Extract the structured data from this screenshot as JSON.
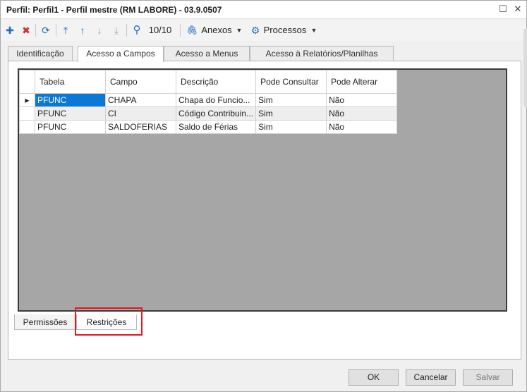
{
  "window": {
    "title": "Perfil: Perfil1 - Perfil mestre (RM LABORE) - 03.9.0507",
    "maximize_glyph": "☐",
    "close_glyph": "✕"
  },
  "toolbar": {
    "add_glyph": "✚",
    "delete_glyph": "✖",
    "refresh_glyph": "⟳",
    "first_glyph": "⤒",
    "prev_glyph": "↑",
    "next_glyph": "↓",
    "last_glyph": "⤓",
    "search_glyph": "⚲",
    "record_position": "10/10",
    "attachments_glyph": "🖇",
    "attachments_label": "Anexos",
    "processes_glyph": "⚙",
    "processes_label": "Processos",
    "dropdown_glyph": "▼"
  },
  "tabs": [
    {
      "label": "Identificação",
      "active": false
    },
    {
      "label": "Acesso a Campos",
      "active": true
    },
    {
      "label": "Acesso a Menus",
      "active": false
    },
    {
      "label": "Acesso à Relatórios/Planilhas",
      "active": false
    }
  ],
  "grid": {
    "columns": [
      "Tabela",
      "Campo",
      "Descrição",
      "Pode Consultar",
      "Pode Alterar"
    ],
    "current_row_glyph": "▶",
    "rows": [
      {
        "tabela": "PFUNC",
        "campo": "CHAPA",
        "descricao": "Chapa do Funcio...",
        "consultar": "Sim",
        "alterar": "Não"
      },
      {
        "tabela": "PFUNC",
        "campo": "CI",
        "descricao": "Código Contribuin...",
        "consultar": "Sim",
        "alterar": "Não"
      },
      {
        "tabela": "PFUNC",
        "campo": "SALDOFERIAS",
        "descricao": "Saldo de Férias",
        "consultar": "Sim",
        "alterar": "Não"
      }
    ]
  },
  "bottom_tabs": [
    {
      "label": "Permissões",
      "active": false
    },
    {
      "label": "Restrições",
      "active": true
    }
  ],
  "footer": {
    "ok_label": "OK",
    "cancel_label": "Cancelar",
    "save_label": "Salvar"
  },
  "colors": {
    "selection": "#0a78d4",
    "highlight_box": "#e8141e",
    "add_icon": "#1b6ec2",
    "delete_icon": "#d12a2a",
    "nav_icon": "#1b6ec2"
  }
}
